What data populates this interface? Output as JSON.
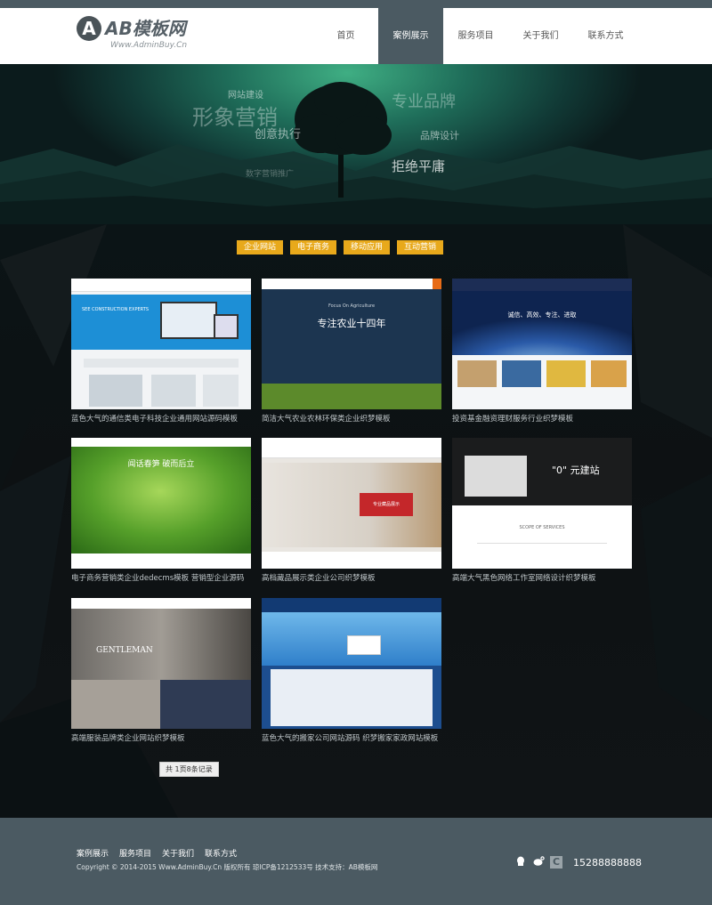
{
  "brand": {
    "logo_letter": "A",
    "logo_text": "AB模板网",
    "logo_sub": "Www.AdminBuy.Cn"
  },
  "nav": [
    {
      "label": "首页",
      "active": false
    },
    {
      "label": "案例展示",
      "active": true
    },
    {
      "label": "服务项目",
      "active": false
    },
    {
      "label": "关于我们",
      "active": false
    },
    {
      "label": "联系方式",
      "active": false
    }
  ],
  "banner": {
    "words": [
      "网站建设",
      "形象营销",
      "创意执行",
      "专业品牌",
      "品牌设计",
      "拒绝平庸",
      "数字营销推广"
    ]
  },
  "filters": [
    "企业网站",
    "电子商务",
    "移动应用",
    "互动营销"
  ],
  "cases": [
    {
      "caption": "蓝色大气的通信类电子科技企业通用网站源码模板",
      "theme": "blue-tech"
    },
    {
      "caption": "简洁大气农业农林环保类企业织梦模板",
      "theme": "agri-dark"
    },
    {
      "caption": "投资基金融资理财服务行业织梦模板",
      "theme": "finance"
    },
    {
      "caption": "电子商务营销类企业dedecms模板 营销型企业源码",
      "theme": "green"
    },
    {
      "caption": "高档藏品展示类企业公司织梦模板",
      "theme": "interior"
    },
    {
      "caption": "高端大气黑色网络工作室网络设计织梦模板",
      "theme": "dark-studio"
    },
    {
      "caption": "高端服装品牌类企业网站织梦模板",
      "theme": "fashion"
    },
    {
      "caption": "蓝色大气的搬家公司网站源码 织梦搬家家政网站模板",
      "theme": "moving"
    }
  ],
  "pager": "共 1页8条记录",
  "footer": {
    "links": [
      "案例展示",
      "服务项目",
      "关于我们",
      "联系方式"
    ],
    "copyright": "Copyright © 2014-2015 Www.AdminBuy.Cn 版权所有  琼ICP备1212533号  技术支持：AB模板网",
    "phone": "15288888888"
  },
  "thumb_text": {
    "t1_title": "SEE CONSTRUCTION EXPERTS",
    "t2_title": "专注农业十四年",
    "t2_sub": "Focus On Agriculture",
    "t3_title": "诚信、高效、专注、进取",
    "t4_title": "闻话春笋  破而后立",
    "t5_title": "专业藏品展示",
    "t6_title": "\"0\" 元建站",
    "t6_sub": "SCOPE OF SERVICES",
    "t7_title": "GENTLEMAN"
  },
  "colors": {
    "accent": "#e8a91b",
    "header_dark": "#4b5a62"
  }
}
